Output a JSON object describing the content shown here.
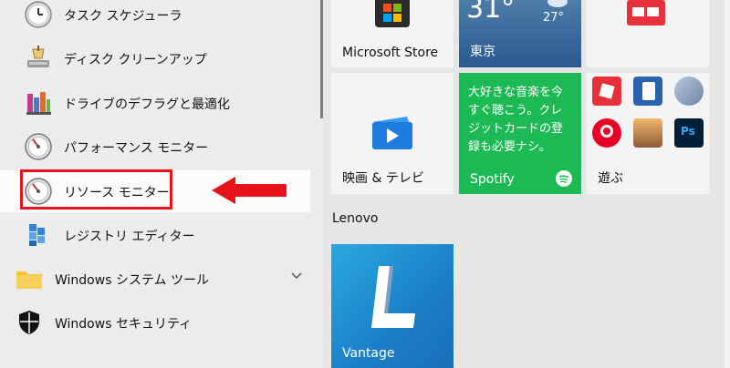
{
  "start_menu": {
    "apps": [
      {
        "label": "タスク スケジューラ",
        "icon": "clock-icon"
      },
      {
        "label": "ディスク クリーンアップ",
        "icon": "disk-cleanup-icon"
      },
      {
        "label": "ドライブのデフラグと最適化",
        "icon": "defrag-icon"
      },
      {
        "label": "パフォーマンス モニター",
        "icon": "gauge-icon"
      },
      {
        "label": "リソース モニター",
        "icon": "gauge-icon"
      },
      {
        "label": "レジストリ エディター",
        "icon": "registry-icon"
      }
    ],
    "folder": {
      "label": "Windows システム ツール",
      "icon": "folder-icon"
    },
    "security": {
      "label": "Windows セキュリティ",
      "icon": "shield-icon"
    }
  },
  "tiles": {
    "microsoft_store": {
      "label": "Microsoft Store"
    },
    "weather": {
      "temp": "31°",
      "low": "27°",
      "city": "東京"
    },
    "movies": {
      "label": "映画 & テレビ"
    },
    "spotify": {
      "promo": "大好きな音楽を今すぐ聴こう。クレジットカードの登録も必要ナシ。",
      "label": "Spotify"
    },
    "play": {
      "label": "遊ぶ"
    },
    "lenovo_section": "Lenovo",
    "vantage": {
      "label": "Vantage"
    }
  },
  "colors": {
    "highlight_box": "#e8121b",
    "arrow": "#e8121b",
    "spotify_green": "#1db954"
  }
}
